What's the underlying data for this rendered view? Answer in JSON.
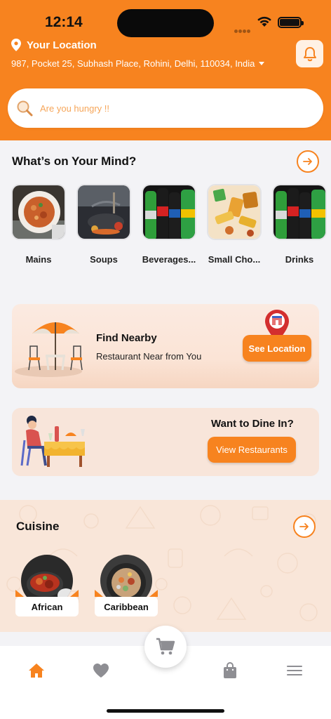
{
  "status_bar": {
    "time": "12:14"
  },
  "header": {
    "location_title": "Your Location",
    "address": "987, Pocket 25, Subhash Place, Rohini, Delhi, 110034, India"
  },
  "search": {
    "placeholder": "Are you hungry !!"
  },
  "mind_section": {
    "title": "What’s on Your Mind?",
    "items": [
      {
        "label": "Mains"
      },
      {
        "label": "Soups"
      },
      {
        "label": "Beverages..."
      },
      {
        "label": "Small Cho..."
      },
      {
        "label": "Drinks"
      }
    ]
  },
  "nearby_card": {
    "title": "Find Nearby",
    "subtitle": "Restaurant Near from You",
    "button": "See Location"
  },
  "dine_card": {
    "title": "Want to Dine In?",
    "button": "View Restaurants"
  },
  "cuisine_section": {
    "title": "Cuisine",
    "items": [
      {
        "label": "African"
      },
      {
        "label": "Caribbean"
      }
    ]
  },
  "colors": {
    "accent": "#F7831F",
    "background": "#F3F3F6",
    "cuisine_bg": "#F9E6D9"
  },
  "bottom_nav": {
    "items": [
      {
        "icon": "home-icon",
        "active": true
      },
      {
        "icon": "heart-icon",
        "active": false
      },
      {
        "icon": "shopping-bag-icon",
        "active": false
      },
      {
        "icon": "menu-icon",
        "active": false
      }
    ],
    "center_icon": "cart-icon"
  }
}
